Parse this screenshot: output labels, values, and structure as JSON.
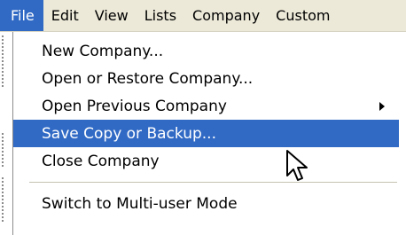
{
  "menubar": {
    "items": [
      {
        "label": "File",
        "active": true
      },
      {
        "label": "Edit",
        "active": false
      },
      {
        "label": "View",
        "active": false
      },
      {
        "label": "Lists",
        "active": false
      },
      {
        "label": "Company",
        "active": false
      },
      {
        "label": "Custom",
        "active": false
      }
    ]
  },
  "file_menu": {
    "items": [
      {
        "label": "New Company...",
        "highlighted": false,
        "has_submenu": false
      },
      {
        "label": "Open or Restore Company...",
        "highlighted": false,
        "has_submenu": false
      },
      {
        "label": "Open Previous Company",
        "highlighted": false,
        "has_submenu": true
      },
      {
        "label": "Save Copy or Backup...",
        "highlighted": true,
        "has_submenu": false
      },
      {
        "label": "Close Company",
        "highlighted": false,
        "has_submenu": false
      },
      {
        "label": "Switch to Multi-user Mode",
        "highlighted": false,
        "has_submenu": false
      }
    ],
    "submenu_icon": "chevron-right-icon"
  },
  "colors": {
    "highlight": "#316ac5",
    "menubar_bg": "#ece9d8",
    "menu_bg": "#ffffff"
  },
  "cursor_icon": "arrow-cursor-icon"
}
